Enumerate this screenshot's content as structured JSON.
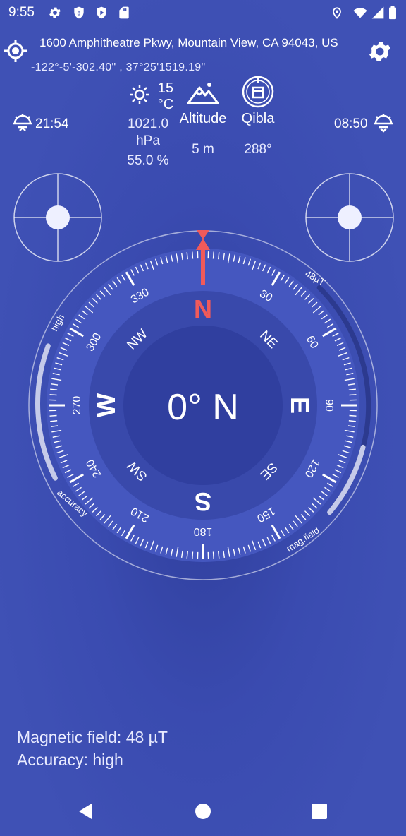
{
  "status_bar": {
    "time": "9:55",
    "icons": [
      "settings-icon",
      "vpn-badge-icon",
      "play-protect-icon",
      "sd-card-icon",
      "location-icon",
      "wifi-icon",
      "signal-icon",
      "battery-icon"
    ]
  },
  "header": {
    "address": "1600 Amphitheatre Pkwy, Mountain View, CA 94043, US",
    "coordinates": "-122°-5'-302.40\" , 37°25'1519.19\"",
    "left_icon": "my-location-icon",
    "right_icon": "gear-icon"
  },
  "sun": {
    "sunrise_time": "21:54",
    "sunset_time": "08:50"
  },
  "weather": {
    "temperature_value": "15",
    "temperature_unit": "°C",
    "pressure_value": "1021.0",
    "pressure_unit": "hPa",
    "humidity": "55.0 %"
  },
  "altitude": {
    "label": "Altitude",
    "value": "5 m"
  },
  "qibla": {
    "label": "Qibla",
    "value": "288°"
  },
  "compass": {
    "heading_text": "0° N",
    "cardinals": {
      "n": "N",
      "e": "E",
      "s": "S",
      "w": "W"
    },
    "intercardinals": {
      "ne": "NE",
      "se": "SE",
      "sw": "SW",
      "nw": "NW"
    },
    "degree_labels": [
      "30",
      "60",
      "90",
      "120",
      "150",
      "180",
      "210",
      "240",
      "270",
      "300",
      "330"
    ],
    "arc_labels": {
      "mag_field_value": "48µT",
      "mag_field": "mag.field",
      "accuracy": "accuracy",
      "accuracy_level": "high"
    },
    "colors": {
      "north": "#f05a5a",
      "outer_dial": "#3f51b5",
      "inner_dial": "#3949ab",
      "center": "#303f9f"
    }
  },
  "bottom": {
    "magnetic_field": "Magnetic field: 48 µT",
    "accuracy": "Accuracy: high"
  },
  "nav_bar": {
    "back": "back-icon",
    "home": "home-icon",
    "recents": "recents-icon"
  }
}
